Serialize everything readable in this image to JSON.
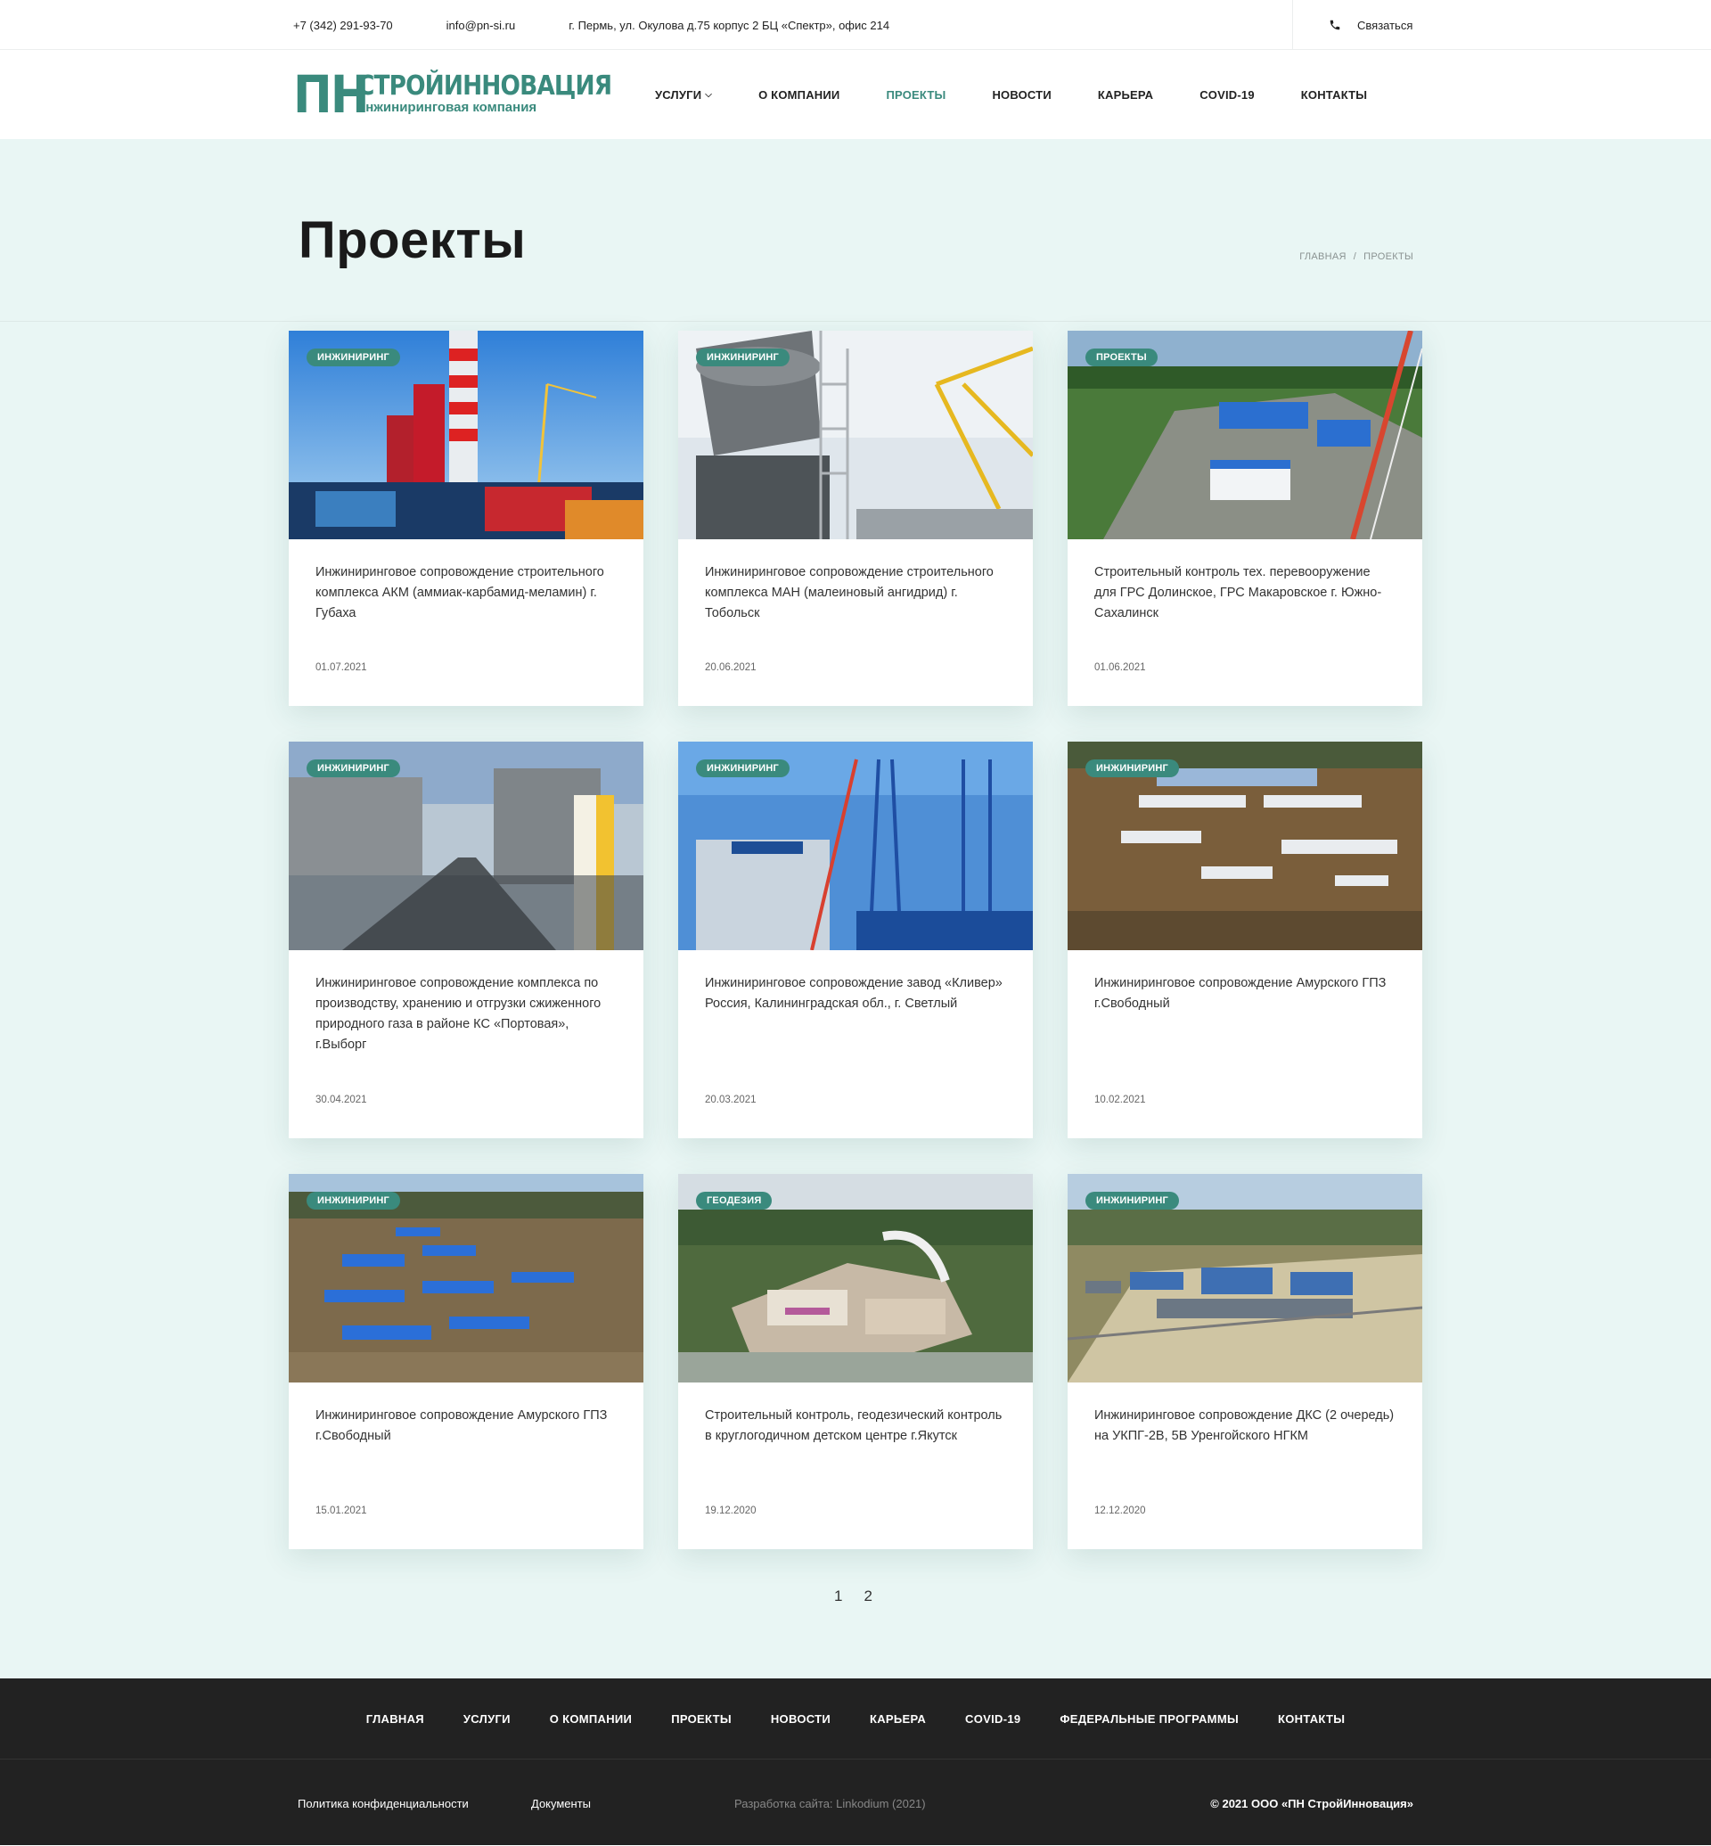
{
  "topbar": {
    "phone": "+7 (342) 291-93-70",
    "email": "info@pn-si.ru",
    "address": "г. Пермь, ул. Окулова д.75 корпус 2 БЦ «Спектр», офис 214",
    "contact_label": "Связаться"
  },
  "logo": {
    "mark": "ПН",
    "brand": "СТРОЙИННОВАЦИЯ",
    "tagline": "инжиниринговая компания"
  },
  "nav": {
    "services": "УСЛУГИ",
    "about": "О КОМПАНИИ",
    "projects": "ПРОЕКТЫ",
    "news": "НОВОСТИ",
    "career": "КАРЬЕРА",
    "covid": "COVID-19",
    "contacts": "КОНТАКТЫ"
  },
  "page": {
    "title": "Проекты"
  },
  "breadcrumb": {
    "home": "ГЛАВНАЯ",
    "current": "ПРОЕКТЫ"
  },
  "cards": [
    {
      "badge": "ИНЖИНИРИНГ",
      "title": "Инжиниринговое сопровождение строительного комплекса АКМ (аммиак-карбамид-меламин) г. Губаха",
      "date": "01.07.2021"
    },
    {
      "badge": "ИНЖИНИРИНГ",
      "title": "Инжиниринговое сопровождение строительного комплекса МАН (малеиновый ангидрид) г. Тобольск",
      "date": "20.06.2021"
    },
    {
      "badge": "ПРОЕКТЫ",
      "title": "Строительный контроль тех. перевооружение для ГРС Долинское, ГРС Макаровское г. Южно-Сахалинск",
      "date": "01.06.2021"
    },
    {
      "badge": "ИНЖИНИРИНГ",
      "title": "Инжиниринговое сопровождение комплекса по производству, хранению и отгрузки сжиженного природного газа в районе КС «Портовая», г.Выборг",
      "date": "30.04.2021"
    },
    {
      "badge": "ИНЖИНИРИНГ",
      "title": "Инжиниринговое сопровождение завод «Кливер» Россия, Калининградская обл., г. Светлый",
      "date": "20.03.2021"
    },
    {
      "badge": "ИНЖИНИРИНГ",
      "title": "Инжиниринговое сопровождение Амурского ГПЗ г.Свободный",
      "date": "10.02.2021"
    },
    {
      "badge": "ИНЖИНИРИНГ",
      "title": "Инжиниринговое сопровождение Амурского ГПЗ г.Свободный",
      "date": "15.01.2021"
    },
    {
      "badge": "ГЕОДЕЗИЯ",
      "title": "Строительный контроль, геодезический контроль в круглогодичном детском центре г.Якутск",
      "date": "19.12.2020"
    },
    {
      "badge": "ИНЖИНИРИНГ",
      "title": "Инжиниринговое сопровождение ДКС (2 очередь) на УКПГ-2В, 5В Уренгойского НГКМ",
      "date": "12.12.2020"
    }
  ],
  "pagination": {
    "page1": "1",
    "page2": "2"
  },
  "footer": {
    "nav": {
      "home": "ГЛАВНАЯ",
      "services": "УСЛУГИ",
      "about": "О КОМПАНИИ",
      "projects": "ПРОЕКТЫ",
      "news": "НОВОСТИ",
      "career": "КАРЬЕРА",
      "covid": "COVID-19",
      "federal": "ФЕДЕРАЛЬНЫЕ ПРОГРАММЫ",
      "contacts": "КОНТАКТЫ"
    },
    "privacy": "Политика конфиденциальности",
    "docs": "Документы",
    "dev": "Разработка сайта: Linkodium (2021)",
    "copyright": "© 2021 ООО «ПН СтройИнновация»"
  },
  "colors": {
    "accent": "#3a8a7d",
    "hero_bg": "#e9f6f4",
    "footer_bg": "#222222"
  }
}
